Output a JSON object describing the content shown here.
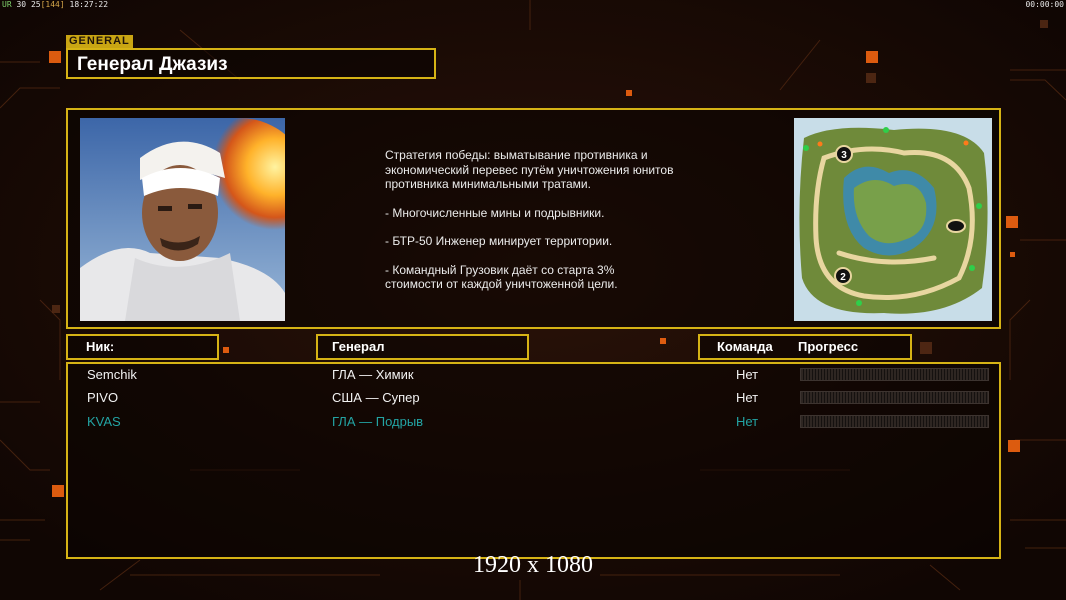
{
  "status": {
    "left_prefix": "UR",
    "left_fps": "30",
    "left_latency": "25",
    "left_bracket": "[144]",
    "left_time": "18:27:22",
    "right_timer": "00:00:00"
  },
  "general_tag": "GENERAL",
  "general_name": "Генерал Джазиз",
  "description": [
    "Стратегия победы: выматывание противника и\n экономический перевес путём уничтожения юнитов\n противника минимальными тратами.",
    "- Многочисленные мины и подрывники.",
    "- БТР-50 Инженер минирует территории.",
    "- Командный Грузовик даёт со старта 3%\n стоимости от каждой уничтоженной цели."
  ],
  "minimap": {
    "marker_3": "3",
    "marker_2": "2"
  },
  "headers": {
    "nick": "Ник:",
    "general": "Генерал",
    "team": "Команда",
    "progress": "Прогресс"
  },
  "players": [
    {
      "nick": "Semchik",
      "general": "ГЛА — Химик",
      "team": "Нет",
      "progress": 0.0,
      "local": false
    },
    {
      "nick": "PIVO",
      "general": "США — Супер",
      "team": "Нет",
      "progress": 0.0,
      "local": false
    },
    {
      "nick": "KVAS",
      "general": "ГЛА — Подрыв",
      "team": "Нет",
      "progress": 0.0,
      "local": true
    }
  ],
  "resolution_label": "1920 x 1080",
  "colors": {
    "frame": "#d6b315",
    "local_player": "#23a4a4",
    "accent_orange": "#ff7a1a"
  }
}
